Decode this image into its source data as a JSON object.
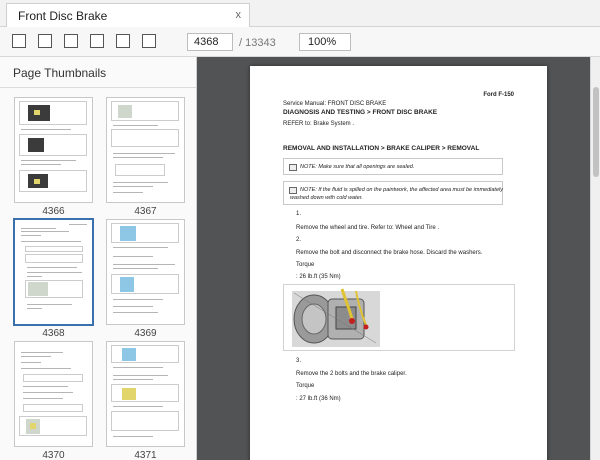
{
  "tab": {
    "title": "Front Disc Brake",
    "close": "x"
  },
  "toolbar": {
    "buttons": [
      "first-page",
      "previous-page",
      "next-page",
      "last-page",
      "rotate",
      "print"
    ],
    "page": "4368",
    "page_total": "/ 13343",
    "zoom": "100%"
  },
  "sidebar": {
    "title": "Page Thumbnails",
    "thumbnails": [
      {
        "label": "4366"
      },
      {
        "label": "4367"
      },
      {
        "label": "4368",
        "selected": true
      },
      {
        "label": "4369"
      },
      {
        "label": "4370"
      },
      {
        "label": "4371"
      }
    ]
  },
  "document": {
    "brand": "Ford F-150",
    "service_manual": "Service Manual: FRONT DISC BRAKE",
    "section_title": "DIAGNOSIS AND TESTING > FRONT DISC BRAKE",
    "refer_to": "REFER to: Brake System .",
    "procedure_title": "REMOVAL AND INSTALLATION > BRAKE CALIPER > REMOVAL",
    "note1": "NOTE: Make sure that all openings are sealed.",
    "note2_line1": "NOTE: If the fluid is spilled on the paintwork, the affected area must be immediately",
    "note2_line2": "washed down with cold water.",
    "step1_num": "1.",
    "step1_text": "Remove the wheel and tire. Refer to: Wheel and Tire .",
    "step2_num": "2.",
    "step2_text": "Remove the bolt and disconnect the brake hose. Discard the washers.",
    "torque_label_1": "Torque",
    "torque_value_1": ": 26 lb.ft (35 Nm)",
    "step3_num": "3.",
    "step3_text": "Remove the 2 bolts and the brake caliper.",
    "torque_label_2": "Torque",
    "torque_value_2": ": 27 lb.ft (36 Nm)"
  }
}
